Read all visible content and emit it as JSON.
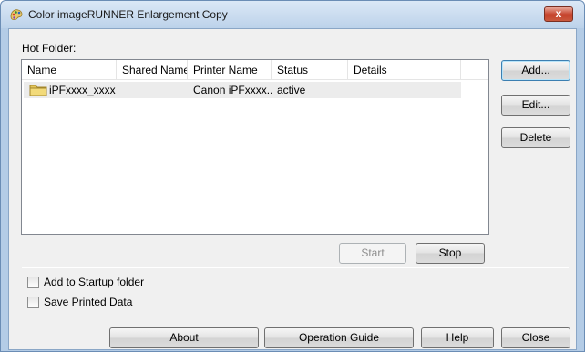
{
  "window": {
    "title": "Color imageRUNNER Enlargement Copy",
    "close_label": "x"
  },
  "hot_folder": {
    "label": "Hot Folder:",
    "columns": [
      "Name",
      "Shared Name",
      "Printer Name",
      "Status",
      "Details"
    ],
    "rows": [
      {
        "name": "iPFxxxx_xxxx",
        "shared_name": "",
        "printer_name": "Canon iPFxxxx...",
        "status": "active",
        "details": ""
      }
    ]
  },
  "side_buttons": {
    "add": "Add...",
    "edit": "Edit...",
    "delete": "Delete"
  },
  "control_buttons": {
    "start": "Start",
    "stop": "Stop"
  },
  "options": {
    "add_to_startup": {
      "label": "Add to Startup folder",
      "checked": false
    },
    "save_printed_data": {
      "label": "Save Printed Data",
      "checked": false
    }
  },
  "footer_buttons": {
    "about": "About",
    "operation_guide": "Operation Guide",
    "help": "Help",
    "close": "Close"
  },
  "colors": {
    "titlebar": "#bcd2ea",
    "close_button": "#c5412a",
    "client_background": "#f0f0f0",
    "default_button_border": "#3c7fb1"
  },
  "icons": {
    "app": "app-palette-icon",
    "folder": "folder-icon"
  }
}
